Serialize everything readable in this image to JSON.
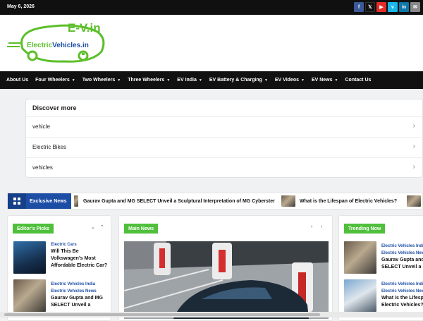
{
  "topbar": {
    "date": "May 6, 2026",
    "socials": [
      {
        "icon": "facebook-icon",
        "glyph": "f",
        "color": "#3b5998"
      },
      {
        "icon": "x-twitter-icon",
        "glyph": "𝕏",
        "color": "#111111"
      },
      {
        "icon": "youtube-icon",
        "glyph": "▶",
        "color": "#e52d27"
      },
      {
        "icon": "vimeo-icon",
        "glyph": "v",
        "color": "#1ab7ea"
      },
      {
        "icon": "linkedin-icon",
        "glyph": "in",
        "color": "#0e76a8"
      },
      {
        "icon": "email-icon",
        "glyph": "✉",
        "color": "#888888"
      }
    ]
  },
  "logo": {
    "top_text": "E-V.in",
    "main_text_1": "Electric",
    "main_text_2": "Vehicles.in"
  },
  "nav": {
    "items": [
      {
        "label": "About Us",
        "dropdown": false
      },
      {
        "label": "Four Wheelers",
        "dropdown": true
      },
      {
        "label": "Two Wheelers",
        "dropdown": true
      },
      {
        "label": "Three Wheelers",
        "dropdown": true
      },
      {
        "label": "EV India",
        "dropdown": true
      },
      {
        "label": "EV Battery & Charging",
        "dropdown": true
      },
      {
        "label": "EV Videos",
        "dropdown": true
      },
      {
        "label": "EV News",
        "dropdown": true
      },
      {
        "label": "Contact Us",
        "dropdown": false
      }
    ]
  },
  "discover": {
    "title": "Discover more",
    "items": [
      "vehicle",
      "Electric Bikes",
      "vehicles"
    ]
  },
  "ticker": {
    "label": "Exclusive News",
    "items": [
      "Gaurav Gupta and MG SELECT Unveil a Sculptural Interpretation of MG Cyberster",
      "What is the Lifespan of Electric Vehicles?"
    ]
  },
  "editors_picks": {
    "label": "Editor's Picks",
    "items": [
      {
        "category": "Electric Cars",
        "title": "Will This Be Volkswagen's Most Affordable Electric Car?"
      },
      {
        "category": "Electric Vehicles India",
        "category2": "Electric Vehicles News",
        "title": "Gaurav Gupta and MG SELECT Unveil a"
      }
    ]
  },
  "main_news": {
    "label": "Main News"
  },
  "trending": {
    "label": "Trending Now",
    "items": [
      {
        "category": "Electric Vehicles India",
        "category2": "Electric Vehicles News",
        "title": "Gaurav Gupta and MG SELECT Unveil a"
      },
      {
        "category": "Electric Vehicles India",
        "category2": "Electric Vehicles News",
        "title": "What is the Lifespan of Electric Vehicles?"
      }
    ]
  },
  "colors": {
    "accent_green": "#4fbf3c",
    "accent_blue": "#1d4ea6",
    "nav_bg": "#111111"
  }
}
